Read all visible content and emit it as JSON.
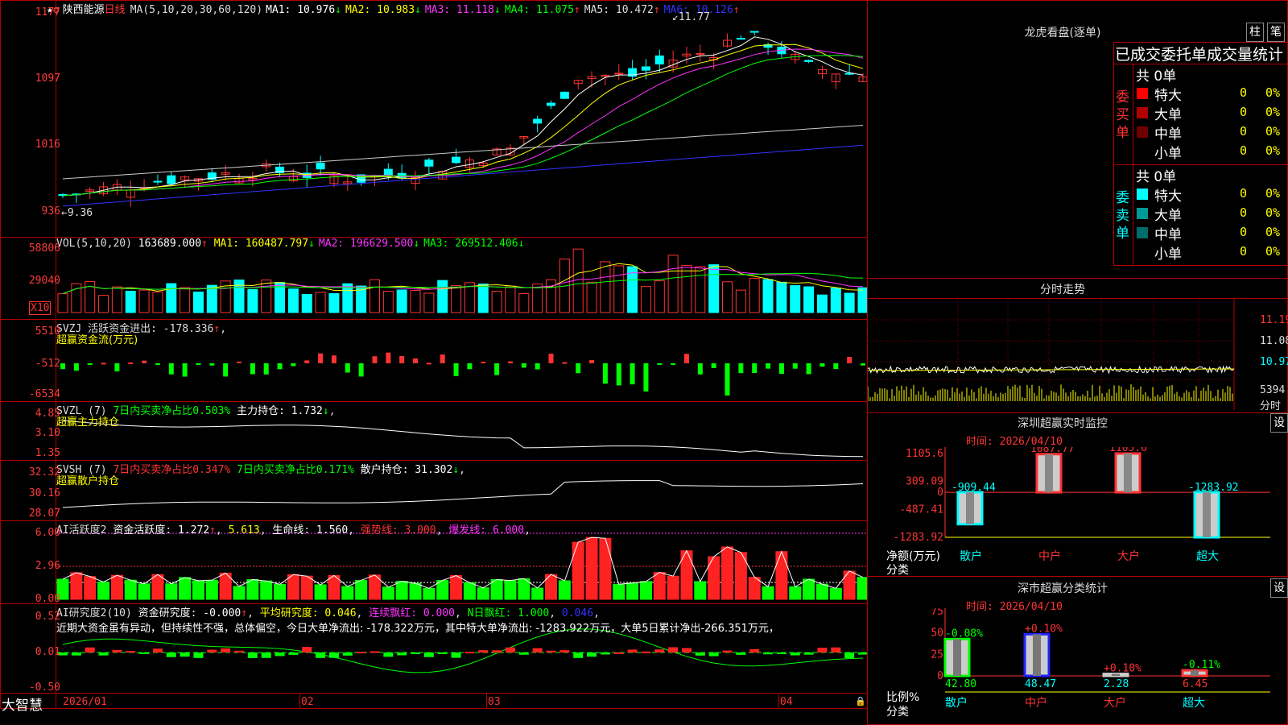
{
  "stock": {
    "name": "陕西能源",
    "period": "日线"
  },
  "kline": {
    "ma_header": "MA(5,10,20,30,60,120)",
    "ma_values": [
      {
        "label": "MA1:",
        "value": "10.976",
        "arrow": "↓",
        "color": "#ffffff"
      },
      {
        "label": "MA2:",
        "value": "10.983",
        "arrow": "↓",
        "color": "#ffff00"
      },
      {
        "label": "MA3:",
        "value": "11.118",
        "arrow": "↓",
        "color": "#ff33ff"
      },
      {
        "label": "MA4:",
        "value": "11.075",
        "arrow": "↑",
        "color": "#00ff00"
      },
      {
        "label": "MA5:",
        "value": "10.472",
        "arrow": "↑",
        "color": "#dddddd"
      },
      {
        "label": "MA6:",
        "value": "10.126",
        "arrow": "↑",
        "color": "#3333ff"
      }
    ],
    "y_ticks": [
      "1177",
      "1097",
      "1016",
      "936"
    ],
    "high_mark": "11.77",
    "low_mark": "9.36"
  },
  "vol": {
    "header": "VOL(5,10,20)",
    "value": "163689.000",
    "arrow": "↑",
    "ma": [
      {
        "label": "MA1:",
        "value": "160487.797",
        "arrow": "↓",
        "color": "#ffff00"
      },
      {
        "label": "MA2:",
        "value": "196629.500",
        "arrow": "↓",
        "color": "#ff33ff"
      },
      {
        "label": "MA3:",
        "value": "269512.406",
        "arrow": "↓",
        "color": "#00ff00"
      }
    ],
    "y_ticks": [
      "58806",
      "29040"
    ],
    "unit": "X10"
  },
  "svzj": {
    "header": "SVZJ",
    "line1": "活跃资金进出: -178.336",
    "arrow": "↑",
    "line2": "超赢资金流(万元)",
    "y_ticks": [
      "5510",
      "-512",
      "-6534"
    ]
  },
  "svzl": {
    "header": "SVZL (7)",
    "part1": "7日内买卖净占比0.503%",
    "part2": "主力持仓: 1.732",
    "arrow": "↓",
    "line2": "超赢主力持仓",
    "y_ticks": [
      "4.85",
      "3.10",
      "1.35"
    ]
  },
  "svsh": {
    "header": "SVSH (7)",
    "part1": "7日内买卖净占比0.347%",
    "part2": "7日内买卖净占比0.171%",
    "part3": "散户持仓: 31.302",
    "arrow": "↓",
    "line2": "超赢散户持仓",
    "y_ticks": [
      "32.32",
      "30.16",
      "28.07"
    ]
  },
  "ai_active": {
    "header": "AI活跃度2",
    "part1": "资金活跃度: 1.272",
    "part2": "5.613",
    "part3": "生命线: 1.560",
    "part4": "强势线: 3.000",
    "part5": "爆发线: 6.000",
    "y_ticks": [
      "6.00",
      "2.96",
      "0.00"
    ]
  },
  "ai_research": {
    "header": "AI研究度2(10)",
    "part1": "资金研究度: -0.000",
    "part2": "平均研究度: 0.046",
    "part3": "连续飘红: 0.000",
    "part4": "N日飘红: 1.000",
    "part5": "0.046",
    "comment": "近期大资金虽有异动，但持续性不强，总体偏空，今日大单净流出: -178.322万元，其中特大单净流出: -1283.922万元，大单5日累计净出-266.351万元，",
    "y_ticks": [
      "0.52",
      "0.01",
      "-0.50"
    ]
  },
  "x_axis": {
    "brand": "大智慧",
    "dates": [
      "2026/01",
      "02",
      "03",
      "04"
    ]
  },
  "right": {
    "lhb_title": "龙虎看盘(逐单)",
    "btn_col": "柱",
    "btn_pen": "笔",
    "table_title": "已成交委托单成交量统计",
    "buy": {
      "side": "委买单",
      "total": "共 0单",
      "rows": [
        {
          "label": "特大",
          "count": "0",
          "pct": "0%",
          "color": "#ff0000"
        },
        {
          "label": "大单",
          "count": "0",
          "pct": "0%",
          "color": "#b00000"
        },
        {
          "label": "中单",
          "count": "0",
          "pct": "0%",
          "color": "#700000"
        },
        {
          "label": "小单",
          "count": "0",
          "pct": "0%",
          "color": "#000000"
        }
      ]
    },
    "sell": {
      "side": "委卖单",
      "total": "共 0单",
      "rows": [
        {
          "label": "特大",
          "count": "0",
          "pct": "0%",
          "color": "#00ffff"
        },
        {
          "label": "大单",
          "count": "0",
          "pct": "0%",
          "color": "#009999"
        },
        {
          "label": "中单",
          "count": "0",
          "pct": "0%",
          "color": "#006b6b"
        },
        {
          "label": "小单",
          "count": "0",
          "pct": "0%",
          "color": "#000000"
        }
      ]
    },
    "intraday": {
      "title": "分时走势",
      "y_ticks": [
        "11.19",
        "11.08",
        "10.97"
      ],
      "vol_tick": "5394",
      "vol_label": "分时"
    },
    "monitor": {
      "title": "深圳超赢实时监控",
      "set": "设",
      "time": "时间: 2026/04/10",
      "y_ticks": [
        "1105.6",
        "309.09",
        "0",
        "-487.41",
        "-1283.92"
      ],
      "ylabel1": "净额(万元)",
      "ylabel2": "分类",
      "categories": [
        "散户",
        "中户",
        "大户",
        "超大"
      ],
      "values": [
        -909.44,
        1087.77,
        1105.6,
        -1283.92
      ],
      "value_labels": [
        "-909.44",
        "1087.77",
        "1105.6",
        "-1283.92"
      ]
    },
    "cls": {
      "title": "深市超赢分类统计",
      "set": "设",
      "time": "时间: 2026/04/10",
      "y_ticks": [
        "75",
        "50",
        "25",
        "0"
      ],
      "ylabel1": "比例%",
      "ylabel2": "分类",
      "categories": [
        "散户",
        "中户",
        "大户",
        "超大"
      ],
      "values": [
        42.8,
        48.47,
        2.28,
        6.45
      ],
      "value_labels": [
        "42.80",
        "48.47",
        "2.28",
        "6.45"
      ],
      "changes": [
        "-0.08%",
        "+0.10%",
        "+0.10%",
        "-0.11%"
      ],
      "colors": [
        "#00ff00",
        "#2222ff",
        "#cccccc",
        "#ff3333"
      ]
    }
  },
  "chart_data": [
    {
      "type": "bar",
      "title": "深圳超赢实时监控",
      "ylabel": "净额(万元)",
      "xlabel": "分类",
      "categories": [
        "散户",
        "中户",
        "大户",
        "超大"
      ],
      "values": [
        -909.44,
        1087.77,
        1105.6,
        -1283.92
      ],
      "ylim": [
        -1283.92,
        1105.6
      ]
    },
    {
      "type": "bar",
      "title": "深市超赢分类统计",
      "ylabel": "比例%",
      "xlabel": "分类",
      "categories": [
        "散户",
        "中户",
        "大户",
        "超大"
      ],
      "values": [
        42.8,
        48.47,
        2.28,
        6.45
      ],
      "ylim": [
        0,
        75
      ]
    }
  ]
}
